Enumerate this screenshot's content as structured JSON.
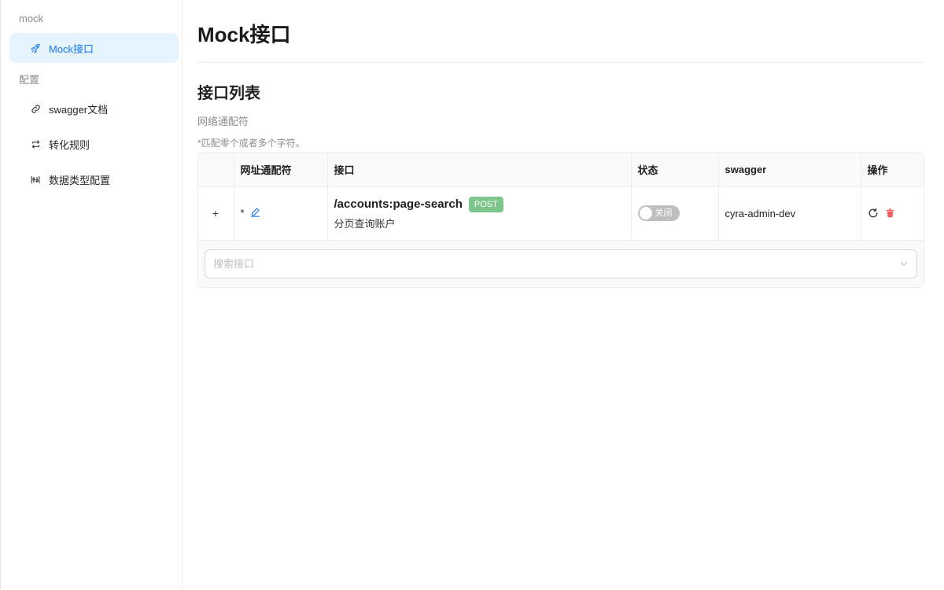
{
  "sidebar": {
    "groups": [
      {
        "title": "mock",
        "items": [
          {
            "label": "Mock接口",
            "icon": "rocket-icon",
            "active": true
          }
        ]
      },
      {
        "title": "配置",
        "items": [
          {
            "label": "swagger文档",
            "icon": "link-icon",
            "active": false
          },
          {
            "label": "转化规则",
            "icon": "swap-icon",
            "active": false
          },
          {
            "label": "数据类型配置",
            "icon": "sliders-icon",
            "active": false
          }
        ]
      }
    ]
  },
  "main": {
    "page_title": "Mock接口",
    "section_title": "接口列表",
    "field_label": "网络通配符",
    "field_hint": "*匹配零个或者多个字符。",
    "table": {
      "columns": [
        "",
        "网址通配符",
        "接口",
        "状态",
        "swagger",
        "操作"
      ],
      "rows": [
        {
          "expand": "+",
          "pattern": "*",
          "path": "/accounts:page-search",
          "method": "POST",
          "description": "分页查询账户",
          "status_text": "关闭",
          "status_on": false,
          "swagger": "cyra-admin-dev"
        }
      ]
    },
    "search": {
      "placeholder": "搜索接口"
    }
  },
  "colors": {
    "accent": "#1677ff",
    "active_bg": "#e6f4ff",
    "method_post": "#7cc68b",
    "danger": "#f25c5c",
    "switch_off": "#bfbfbf"
  }
}
